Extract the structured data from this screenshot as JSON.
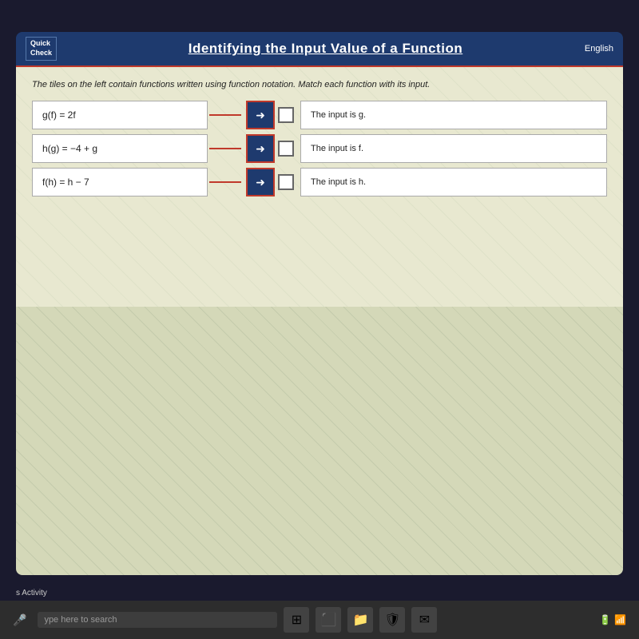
{
  "header": {
    "quick_check_line1": "Quick",
    "quick_check_line2": "Check",
    "title": "Identifying the Input Value of a Function",
    "english_label": "English"
  },
  "main": {
    "instruction": "The tiles on the left contain functions written using function notation. Match each function with its input.",
    "functions": [
      {
        "id": "func1",
        "expression": "g(f) = 2f"
      },
      {
        "id": "func2",
        "expression": "h(g) = −4 + g"
      },
      {
        "id": "func3",
        "expression": "f(h) = h − 7"
      }
    ],
    "answers": [
      {
        "id": "ans1",
        "text": "The input is g."
      },
      {
        "id": "ans2",
        "text": "The input is f."
      },
      {
        "id": "ans3",
        "text": "The input is h."
      }
    ]
  },
  "taskbar": {
    "activity_label": "s Activity",
    "search_placeholder": "ype here to search",
    "icons": [
      "⊞",
      "📁",
      "🛡",
      "✉"
    ]
  }
}
